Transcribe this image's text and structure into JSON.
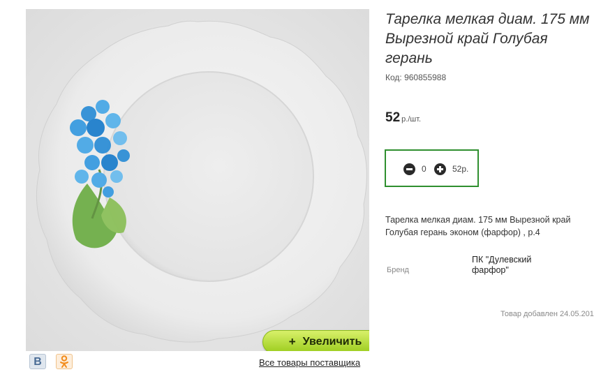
{
  "product": {
    "title": "Тарелка мелкая диам. 175 мм Вырезной край Голубая герань",
    "code": "Код: 960855988",
    "price_value": "52",
    "price_unit": "р./шт.",
    "description": "Тарелка мелкая диам. 175 мм Вырезной край Голубая герань эконом (фарфор) , р.4",
    "brand_label": "Бренд",
    "brand_value": "ПК \"Дулевский фарфор\"",
    "added_text": "Товар добавлен 24.05.201"
  },
  "quantity": {
    "value": "0",
    "sum": "52р."
  },
  "gallery": {
    "zoom_label": "Увеличить",
    "zoom_icon": "+",
    "all_products_link": "Все товары поставщика"
  },
  "social": {
    "vk_label": "В",
    "ok_icon": "odnoklassniki-icon"
  },
  "colors": {
    "accent_green": "#2f8f2f",
    "button_lime": "#b4dc3c"
  }
}
